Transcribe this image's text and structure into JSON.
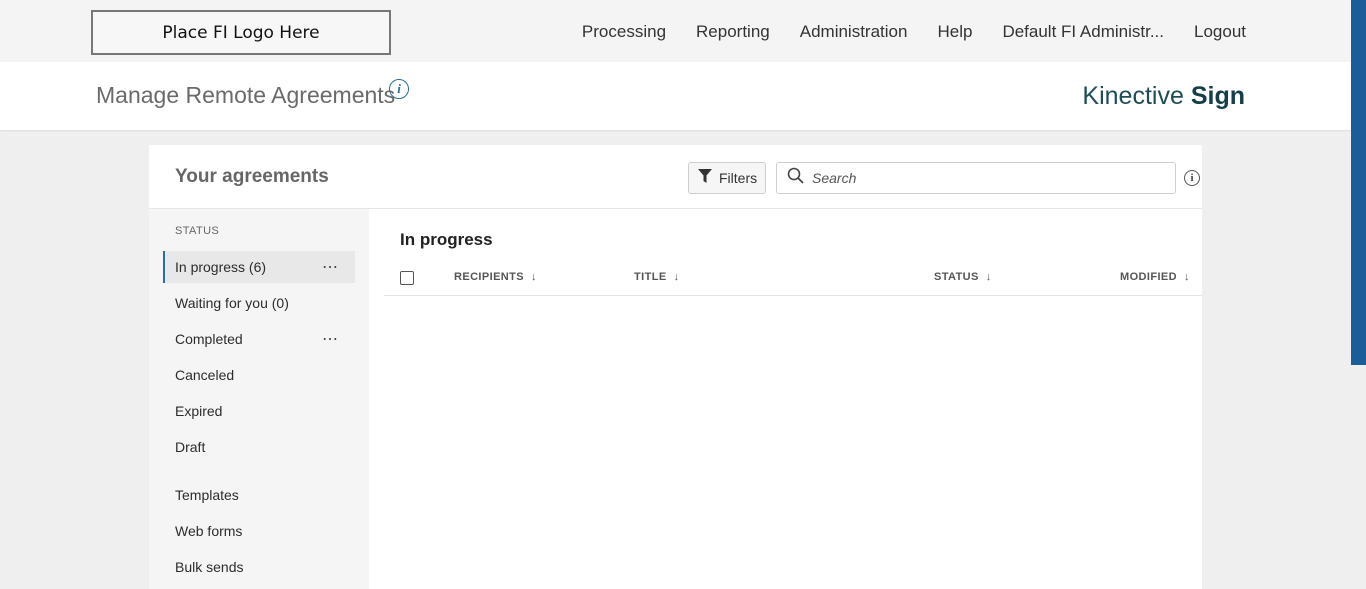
{
  "topbar": {
    "logo_text": "Place FI Logo Here",
    "nav": [
      "Processing",
      "Reporting",
      "Administration",
      "Help",
      "Default FI Administr...",
      "Logout"
    ]
  },
  "header": {
    "title": "Manage Remote Agreements",
    "info_icon": "i",
    "brand_light": "Kinective",
    "brand_bold": "Sign"
  },
  "card": {
    "title": "Your agreements",
    "filters_label": "Filters",
    "search_placeholder": "Search",
    "info_icon": "i"
  },
  "sidebar": {
    "status_label": "STATUS",
    "status_items": [
      {
        "label": "In progress (6)",
        "active": true,
        "has_more": true
      },
      {
        "label": "Waiting for you (0)",
        "active": false,
        "has_more": false
      },
      {
        "label": "Completed",
        "active": false,
        "has_more": true
      },
      {
        "label": "Canceled",
        "active": false,
        "has_more": false
      },
      {
        "label": "Expired",
        "active": false,
        "has_more": false
      },
      {
        "label": "Draft",
        "active": false,
        "has_more": false
      }
    ],
    "other_items": [
      "Templates",
      "Web forms",
      "Bulk sends"
    ],
    "more_glyph": "⋯"
  },
  "list": {
    "title": "In progress",
    "columns": [
      "RECIPIENTS",
      "TITLE",
      "STATUS",
      "MODIFIED"
    ],
    "sort_glyph": "↓"
  },
  "colors": {
    "accent": "#2b6ea0",
    "scroll_thumb": "#1b5d98",
    "brand": "#153f48"
  }
}
